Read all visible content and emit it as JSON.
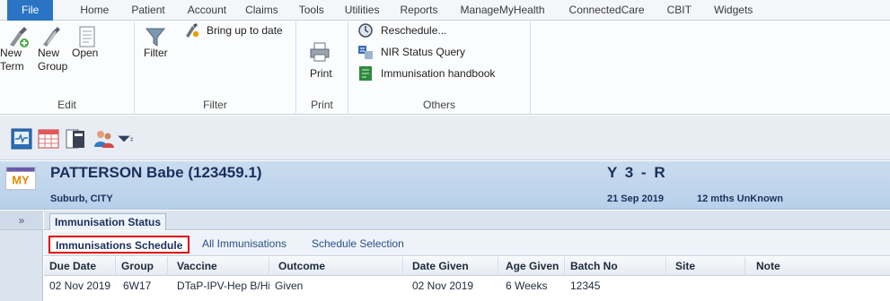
{
  "ribbon_tabs": [
    "File",
    "Home",
    "Patient",
    "Account",
    "Claims",
    "Tools",
    "Utilities",
    "Reports",
    "ManageMyHealth",
    "ConnectedCare",
    "CBIT",
    "Widgets"
  ],
  "edit_group": {
    "new_term": "New Term",
    "new_term_line1": "New",
    "new_term_line2": "Term",
    "new_group_line1": "New",
    "new_group_line2": "Group",
    "open": "Open",
    "label": "Edit",
    "icons": [
      "new-term-icon",
      "new-group-icon",
      "open-document-icon"
    ]
  },
  "filter_group": {
    "filter": "Filter",
    "bring_up_to_date": "Bring up to date",
    "label": "Filter",
    "icons": [
      "filter-funnel-icon",
      "bring-up-to-date-icon"
    ]
  },
  "print_group": {
    "print": "Print",
    "label": "Print",
    "icons": [
      "printer-icon"
    ]
  },
  "others_group": {
    "reschedule": "Reschedule...",
    "nir_status_query": "NIR Status Query",
    "immunisation_handbook": "Immunisation handbook",
    "label": "Others",
    "icons": [
      "reschedule-icon",
      "nir-query-icon",
      "handbook-icon"
    ]
  },
  "quick_toolbar": {
    "icons": [
      "monitor-icon",
      "grid-icon",
      "folder-icon",
      "people-icon",
      "dropdown-arrow-icon"
    ]
  },
  "patient": {
    "name": "PATTERSON Babe (123459.1)",
    "address": "Suburb, CITY",
    "code": "Y 3 - R",
    "date": "21 Sep 2019",
    "age": "12 mths  UnKnown",
    "logo_text": "MY"
  },
  "collapse_chevron": "»",
  "status_tab": "Immunisation Status",
  "subtabs": [
    "Immunisations Schedule",
    "All Immunisations",
    "Schedule Selection"
  ],
  "table": {
    "columns": [
      "Due Date",
      "Group",
      "Vaccine",
      "Outcome",
      "Date Given",
      "Age Given",
      "Batch No",
      "Site",
      "Note"
    ],
    "rows": [
      [
        "02 Nov 2019",
        "6W17",
        "DTaP-IPV-Hep B/Hi...",
        "Given",
        "02 Nov 2019",
        "6 Weeks",
        "12345",
        "",
        ""
      ]
    ]
  },
  "colors": {
    "file_tab": "#2a73c5",
    "active_subtab_border": "#e00000",
    "patient_header": "#c9dcef"
  }
}
